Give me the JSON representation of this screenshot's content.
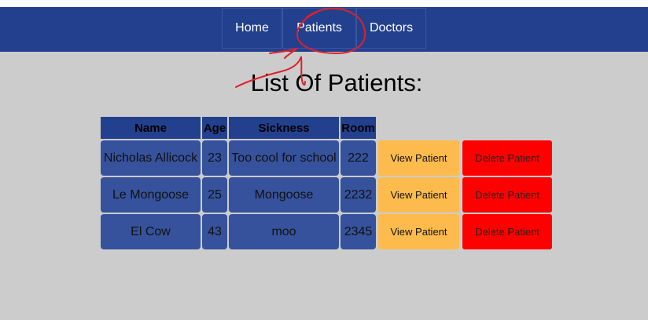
{
  "nav": {
    "items": [
      {
        "label": "Home"
      },
      {
        "label": "Patients"
      },
      {
        "label": "Doctors"
      }
    ]
  },
  "page": {
    "title": "List Of Patients:"
  },
  "table": {
    "headers": {
      "name": "Name",
      "age": "Age",
      "sickness": "Sickness",
      "room": "Room"
    },
    "rows": [
      {
        "name": "Nicholas Allicock",
        "age": "23",
        "sickness": "Too cool for school",
        "room": "222"
      },
      {
        "name": "Le Mongoose",
        "age": "25",
        "sickness": "Mongoose",
        "room": "2232"
      },
      {
        "name": "El Cow",
        "age": "43",
        "sickness": "moo",
        "room": "2345"
      }
    ],
    "actions": {
      "view_label": "View Patient",
      "delete_label": "Delete Patient"
    }
  },
  "colors": {
    "navbar": "#23408e",
    "content_bg": "#cccccc",
    "table_cell": "#36529c",
    "view_button": "#fdbb4d",
    "delete_button": "#ff0000",
    "annotation": "#e0202a"
  }
}
